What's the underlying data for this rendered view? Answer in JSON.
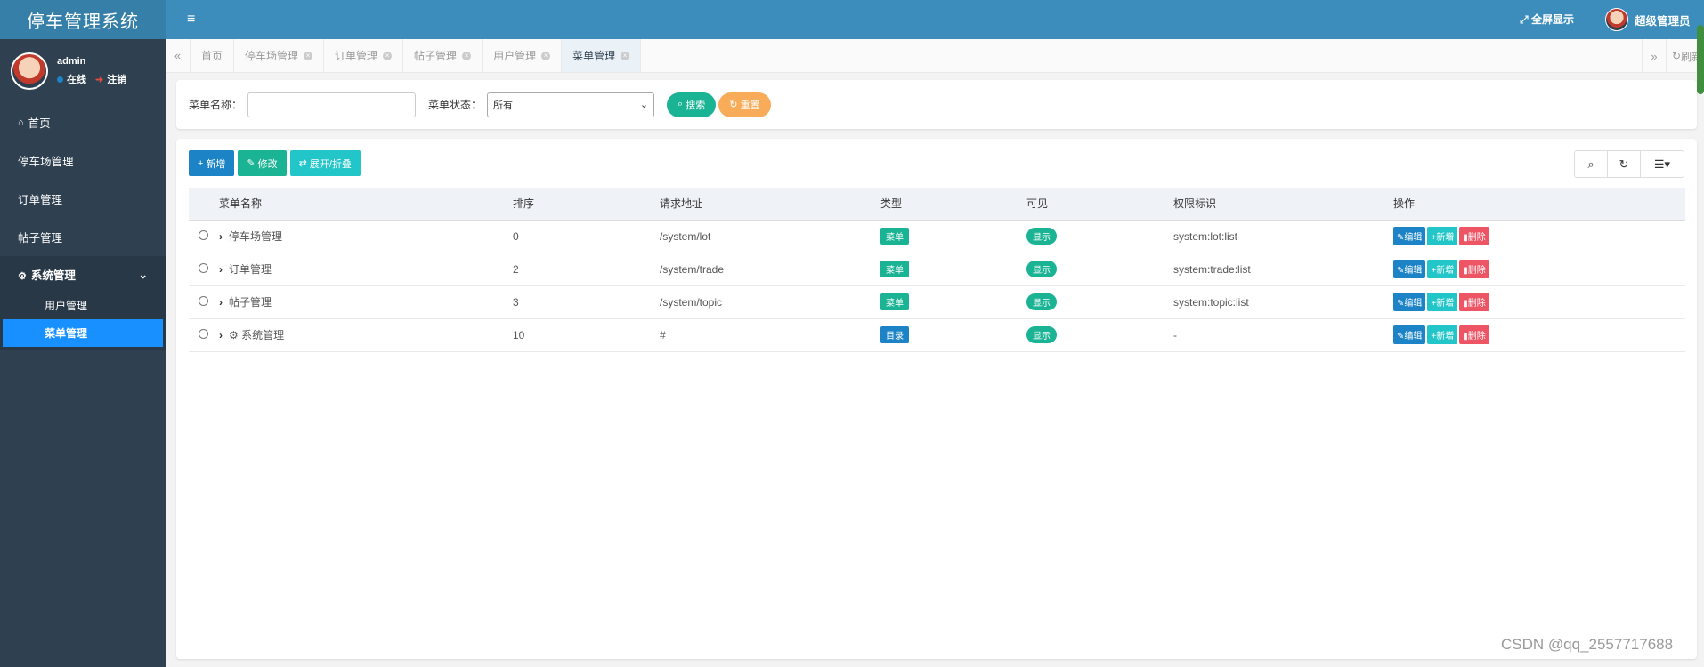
{
  "app": {
    "title": "停车管理系统"
  },
  "user": {
    "name": "admin",
    "online": "在线",
    "logout": "注销"
  },
  "sidebar": {
    "items": [
      {
        "label": "首页"
      },
      {
        "label": "停车场管理"
      },
      {
        "label": "订单管理"
      },
      {
        "label": "帖子管理"
      }
    ],
    "group": {
      "label": "系统管理",
      "children": [
        {
          "label": "用户管理"
        },
        {
          "label": "菜单管理"
        }
      ]
    }
  },
  "topbar": {
    "fullscreen": "全屏显示",
    "admin": "超级管理员"
  },
  "tabs": [
    {
      "label": "首页"
    },
    {
      "label": "停车场管理"
    },
    {
      "label": "订单管理"
    },
    {
      "label": "帖子管理"
    },
    {
      "label": "用户管理"
    },
    {
      "label": "菜单管理"
    }
  ],
  "tab_refresh": "刷新",
  "search": {
    "name_label": "菜单名称：",
    "name_value": "",
    "status_label": "菜单状态：",
    "status_value": "所有",
    "search_btn": "搜索",
    "reset_btn": "重置"
  },
  "toolbar": {
    "add": "新增",
    "edit": "修改",
    "expand": "展开/折叠"
  },
  "table": {
    "headers": [
      "菜单名称",
      "排序",
      "请求地址",
      "类型",
      "可见",
      "权限标识",
      "操作"
    ],
    "rows": [
      {
        "name": "停车场管理",
        "order": "0",
        "url": "/system/lot",
        "type": "菜单",
        "visible": "显示",
        "perm": "system:lot:list"
      },
      {
        "name": "订单管理",
        "order": "2",
        "url": "/system/trade",
        "type": "菜单",
        "visible": "显示",
        "perm": "system:trade:list"
      },
      {
        "name": "帖子管理",
        "order": "3",
        "url": "/system/topic",
        "type": "菜单",
        "visible": "显示",
        "perm": "system:topic:list"
      },
      {
        "name": "系统管理",
        "order": "10",
        "url": "#",
        "type": "目录",
        "visible": "显示",
        "perm": "-"
      }
    ],
    "actions": {
      "edit": "编辑",
      "add": "新增",
      "delete": "删除"
    }
  },
  "watermark": "CSDN @qq_2557717688",
  "colors": {
    "sidebar": "#2f4050",
    "topbar": "#3c8dbc",
    "active": "#1890ff",
    "green": "#1ab394",
    "blue": "#1c84c6",
    "cyan": "#23c6c8",
    "red": "#ed5565",
    "orange": "#f8ac59"
  }
}
